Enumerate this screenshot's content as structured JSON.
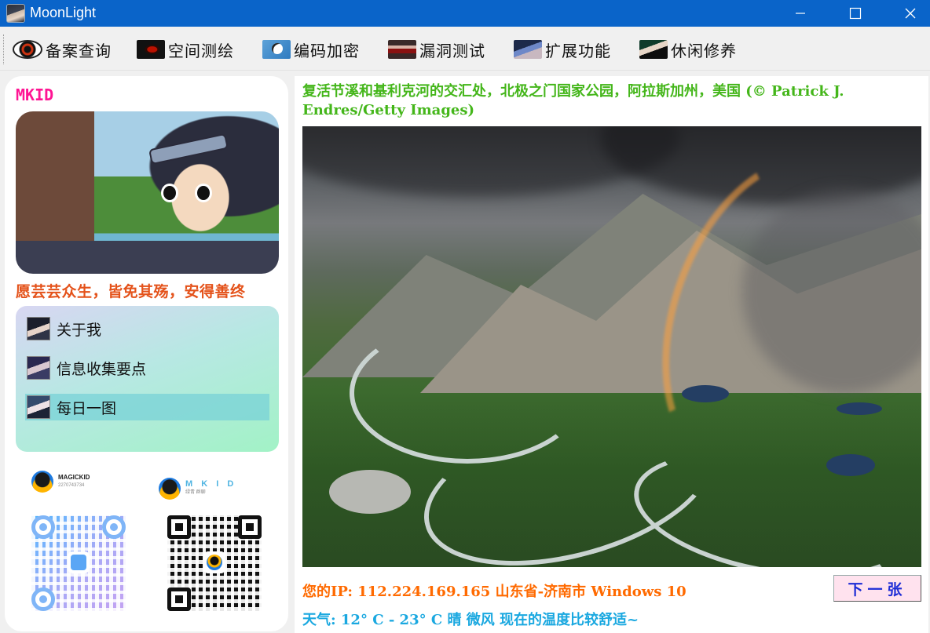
{
  "window": {
    "title": "MoonLight",
    "controls": {
      "minimize": "─",
      "maximize": "☐",
      "close": "✕"
    }
  },
  "menu": {
    "items": [
      {
        "label": "备案查询",
        "icon": "sharingan-eye-icon"
      },
      {
        "label": "空间测绘",
        "icon": "red-eye-icon"
      },
      {
        "label": "编码加密",
        "icon": "panda-icon"
      },
      {
        "label": "漏洞测试",
        "icon": "eye-closeup-icon"
      },
      {
        "label": "扩展功能",
        "icon": "anime-girl-icon"
      },
      {
        "label": "休闲修养",
        "icon": "anime-girl-dark-icon"
      }
    ]
  },
  "profile": {
    "nickname": "MKID",
    "motto": "愿芸芸众生，皆免其殇，安得善终"
  },
  "nav": {
    "items": [
      {
        "label": "关于我",
        "selected": false
      },
      {
        "label": "信息收集要点",
        "selected": false
      },
      {
        "label": "每日一图",
        "selected": true
      }
    ]
  },
  "social": {
    "qq_name": "MAGICKID",
    "qq_number": "2270743734",
    "group_name": "M K I D",
    "group_sub": "绿青 群聊"
  },
  "daily_image": {
    "caption": "复活节溪和基利克河的交汇处，北极之门国家公园，阿拉斯加州，美国 (© Patrick J. Endres/Getty Images)"
  },
  "status": {
    "ip_line": "您的IP: 112.224.169.165 山东省-济南市 Windows 10",
    "weather_line": "天气: 12° C - 23° C 晴 微风 现在的温度比较舒适~",
    "next_button": "下一张"
  },
  "colors": {
    "titlebar": "#0a64c9",
    "nickname": "#ff1493",
    "motto": "#e4521a",
    "caption": "#44b61a",
    "ip": "#ff6a00",
    "weather": "#1aa8e0",
    "next_button_text": "#1d2cd6"
  }
}
